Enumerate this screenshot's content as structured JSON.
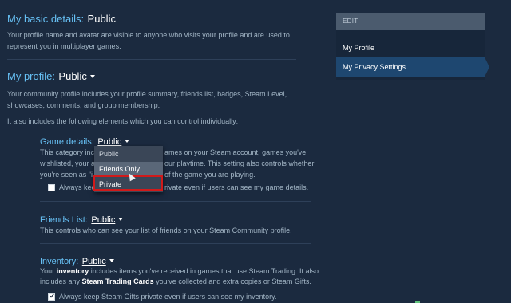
{
  "basic_details": {
    "label": "My basic details:",
    "value": "Public",
    "description": "Your profile name and avatar are visible to anyone who visits your profile and are used to represent you in multiplayer games."
  },
  "profile": {
    "label": "My profile:",
    "value": "Public",
    "description": "Your community profile includes your profile summary, friends list, badges, Steam Level, showcases, comments, and group membership.",
    "elements_intro": "It also includes the following elements which you can control individually:"
  },
  "game_details": {
    "label": "Game details:",
    "value": "Public",
    "desc_line1_a": "This category inc",
    "desc_line1_b": "ames on your Steam account, games you've",
    "desc_line2_a": "wishlisted, your a",
    "desc_line2_b": "our playtime. This setting also controls whether",
    "desc_line3_a": "you're seen as \"i",
    "desc_line3_b": "of the game you are playing.",
    "checkbox_label_a": "Always kee",
    "checkbox_label_b": "rivate even if users can see my game details.",
    "checkbox_checked": false
  },
  "dropdown": {
    "options": [
      "Public",
      "Friends Only",
      "Private"
    ],
    "hovered": "Friends Only",
    "highlighted": "Private"
  },
  "friends_list": {
    "label": "Friends List:",
    "value": "Public",
    "description": "This controls who can see your list of friends on your Steam Community profile."
  },
  "inventory": {
    "label": "Inventory:",
    "value": "Public",
    "desc_line1_a": "Your ",
    "desc_line1_bold": "inventory",
    "desc_line1_b": " includes items you've received in games that use Steam Trading. It also",
    "desc_line2_a": "includes any ",
    "desc_line2_bold": "Steam Trading Cards",
    "desc_line2_b": " you've collected and extra copies or Steam Gifts.",
    "checkbox_label": "Always keep Steam Gifts private even if users can see my inventory.",
    "checkbox_checked": true
  },
  "sidebar": {
    "header": "EDIT",
    "items": [
      {
        "label": "My Profile",
        "active": false
      },
      {
        "label": "My Privacy Settings",
        "active": true
      }
    ]
  },
  "colors": {
    "background": "#1b2a3f",
    "accent_blue": "#67c1f5",
    "active_nav": "#1e4770",
    "highlight_red": "#d11a1a"
  }
}
